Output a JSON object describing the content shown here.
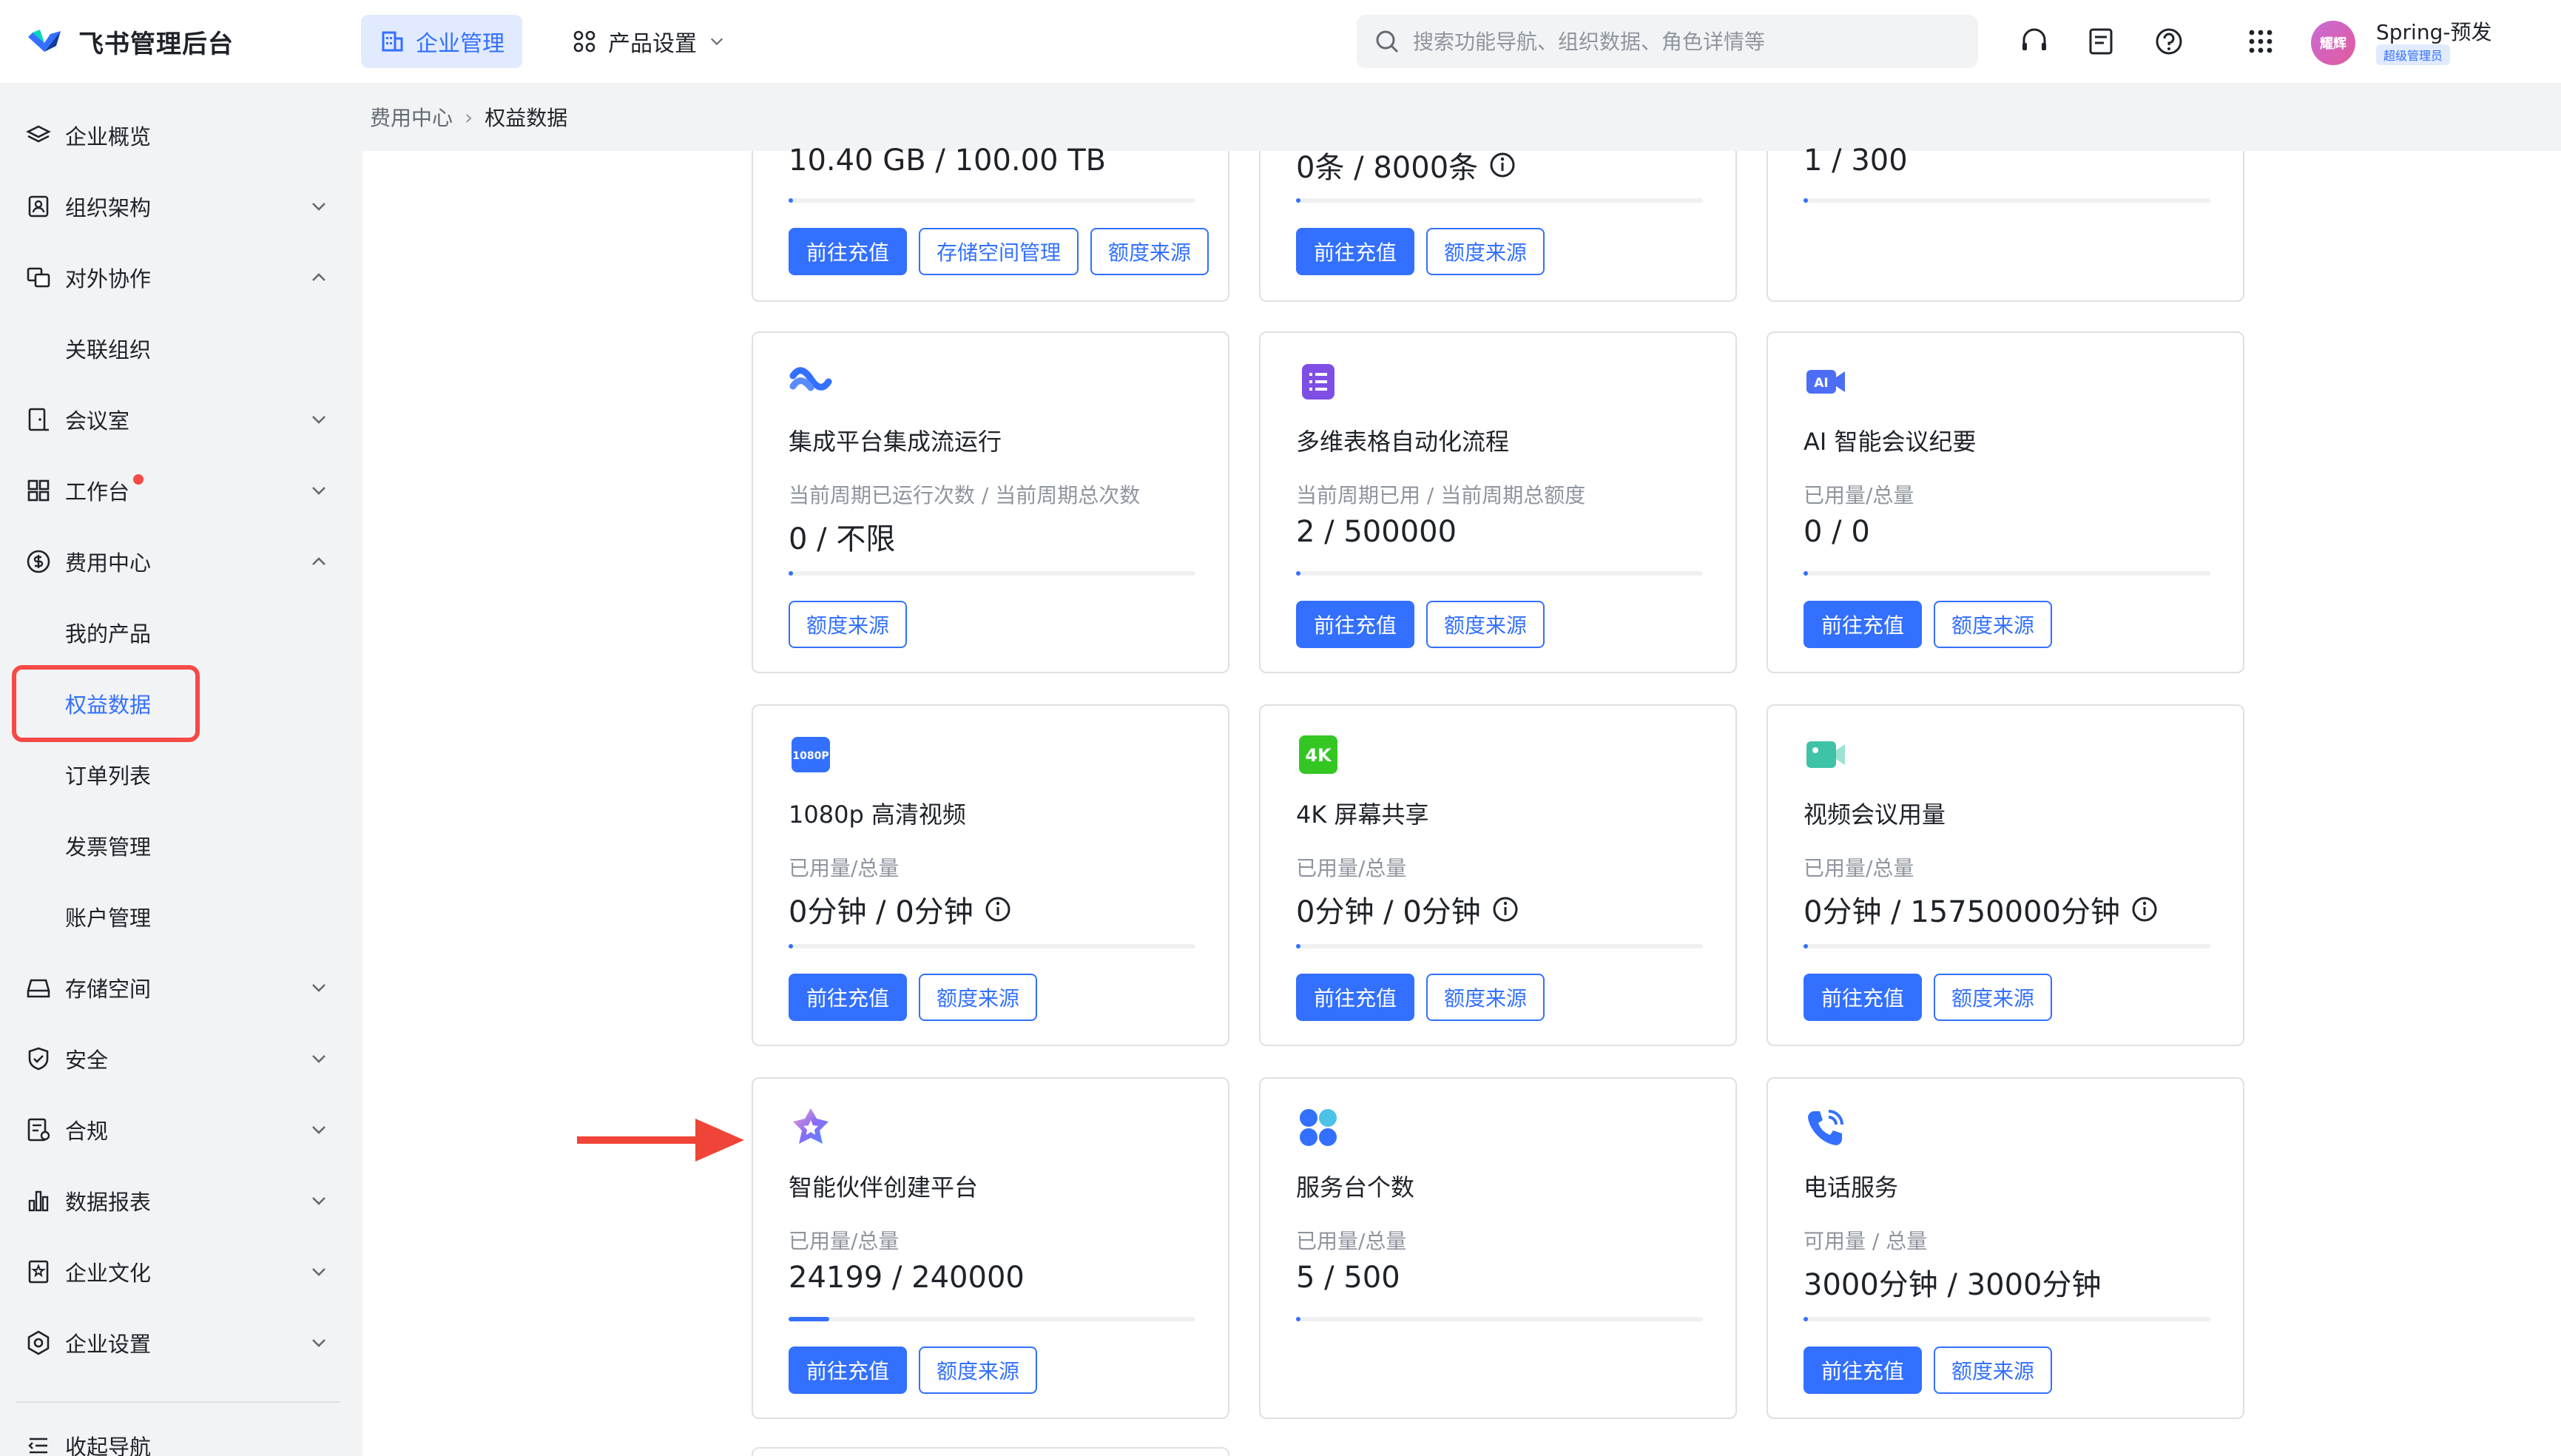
{
  "brand": {
    "name": "飞书管理后台"
  },
  "topnav": {
    "enterprise": "企业管理",
    "product": "产品设置"
  },
  "search": {
    "placeholder": "搜索功能导航、组织数据、角色详情等"
  },
  "user": {
    "avatar_text": "耀辉",
    "name": "Spring-预发",
    "role": "超级管理员"
  },
  "sidebar": {
    "items": [
      {
        "label": "企业概览",
        "icon": "layers-icon"
      },
      {
        "label": "组织架构",
        "icon": "org-icon"
      },
      {
        "label": "对外协作",
        "icon": "collab-icon"
      },
      {
        "label": "关联组织"
      },
      {
        "label": "会议室",
        "icon": "room-icon"
      },
      {
        "label": "工作台",
        "icon": "grid-icon"
      },
      {
        "label": "费用中心",
        "icon": "coin-icon"
      },
      {
        "label": "我的产品"
      },
      {
        "label": "权益数据"
      },
      {
        "label": "订单列表"
      },
      {
        "label": "发票管理"
      },
      {
        "label": "账户管理"
      },
      {
        "label": "存储空间",
        "icon": "storage-icon"
      },
      {
        "label": "安全",
        "icon": "shield-icon"
      },
      {
        "label": "合规",
        "icon": "compliance-icon"
      },
      {
        "label": "数据报表",
        "icon": "chart-icon"
      },
      {
        "label": "企业文化",
        "icon": "culture-icon"
      },
      {
        "label": "企业设置",
        "icon": "gear-icon"
      },
      {
        "label": "收起导航",
        "icon": "collapse-icon"
      }
    ]
  },
  "breadcrumb": {
    "parent": "费用中心",
    "current": "权益数据"
  },
  "buttons": {
    "recharge": "前往充值",
    "source": "额度来源",
    "storage_manage": "存储空间管理"
  },
  "cards": [
    {
      "value": "10.40 GB / 100.00 TB",
      "progress": 0.01
    },
    {
      "value": "0条 / 8000条",
      "progress": 0.01
    },
    {
      "value": "1 / 300",
      "progress": 0.01
    },
    {
      "title": "集成平台集成流运行",
      "sub": "当前周期已运行次数 / 当前周期总次数",
      "value": "0 / 不限",
      "progress": 0.01
    },
    {
      "title": "多维表格自动化流程",
      "sub": "当前周期已用 / 当前周期总额度",
      "value": "2 / 500000",
      "progress": 0.01
    },
    {
      "title": "AI 智能会议纪要",
      "sub": "已用量/总量",
      "value": "0 / 0",
      "progress": 0.01
    },
    {
      "title": "1080p 高清视频",
      "sub": "已用量/总量",
      "value": "0分钟 / 0分钟",
      "progress": 0.01,
      "icon_text": "1080P"
    },
    {
      "title": "4K 屏幕共享",
      "sub": "已用量/总量",
      "value": "0分钟 / 0分钟",
      "progress": 0.01,
      "icon_text": "4K"
    },
    {
      "title": "视频会议用量",
      "sub": "已用量/总量",
      "value": "0分钟 / 15750000分钟",
      "progress": 0.01
    },
    {
      "title": "智能伙伴创建平台",
      "sub": "已用量/总量",
      "value": "24199 / 240000",
      "progress": 0.1
    },
    {
      "title": "服务台个数",
      "sub": "已用量/总量",
      "value": "5 / 500",
      "progress": 0.01
    },
    {
      "title": "电话服务",
      "sub": "可用量 / 总量",
      "value": "3000分钟 / 3000分钟",
      "progress": 0.01
    }
  ],
  "colors": {
    "accent": "#3370ff",
    "highlight": "#f54a45",
    "sidebar_bg": "#f2f3f5"
  }
}
